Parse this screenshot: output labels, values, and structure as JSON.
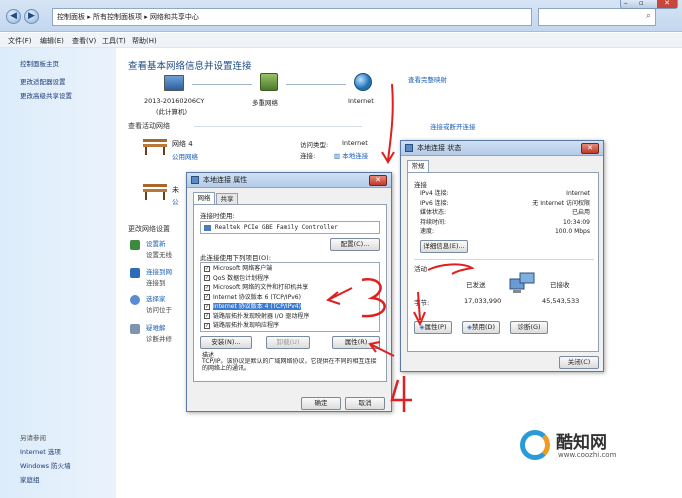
{
  "breadcrumb": {
    "root": "控制面板",
    "mid": "所有控制面板项",
    "current": "网络和共享中心"
  },
  "menu": [
    "文件(F)",
    "编辑(E)",
    "查看(V)",
    "工具(T)",
    "帮助(H)"
  ],
  "sidebar": {
    "home": "控制面板主页",
    "links": [
      "更改适配器设置",
      "更改高级共享设置"
    ],
    "see_also_title": "另请参阅",
    "see_also": [
      "Internet 选项",
      "Windows 防火墙",
      "家庭组"
    ]
  },
  "main": {
    "title": "查看基本网络信息并设置连接",
    "full_map": "查看完整映射",
    "computer_name": "2013-20160206CY",
    "this_computer": "(此计算机)",
    "multi_network": "多重网络",
    "internet": "Internet",
    "active_title": "查看活动网络",
    "connect_disconnect": "连接或断开连接",
    "network1_name": "网络 4",
    "network1_type": "公用网络",
    "access_type_label": "访问类型:",
    "access_type_value": "Internet",
    "connections_label": "连接:",
    "connections_value": "本地连接",
    "network2_name": "未",
    "network2_type": "公",
    "change_title": "更改网络设置",
    "change_items": [
      "设置新",
      "设置无线",
      "连接到网",
      "连接到",
      "选择家",
      "访问位于",
      "疑难解",
      "诊断并修"
    ]
  },
  "props_dialog": {
    "title": "本地连接 属性",
    "tabs": [
      "网络",
      "共享"
    ],
    "connect_using_label": "连接时使用:",
    "adapter": "Realtek PCIe GBE Family Controller",
    "configure": "配置(C)...",
    "items_label": "此连接使用下列项目(O):",
    "items": [
      "Microsoft 网络客户端",
      "QoS 数据包计划程序",
      "Microsoft 网络的文件和打印机共享",
      "Internet 协议版本 6 (TCP/IPv6)",
      "Internet 协议版本 4 (TCP/IPv4)",
      "链路层拓扑发现映射器 I/O 驱动程序",
      "链路层拓扑发现响应程序"
    ],
    "install": "安装(N)...",
    "uninstall": "卸载(U)",
    "properties": "属性(R)",
    "desc_label": "描述",
    "desc_text": "TCP/IP。该协议是默认的广域网络协议，它提供在不同的相互连接的网络上的通讯。",
    "ok": "确定",
    "cancel": "取消"
  },
  "status_dialog": {
    "title": "本地连接 状态",
    "tab": "常规",
    "connection_label": "连接",
    "fields": [
      {
        "label": "IPv4 连接:",
        "value": "Internet"
      },
      {
        "label": "IPv6 连接:",
        "value": "无 Internet 访问权限"
      },
      {
        "label": "媒体状态:",
        "value": "已启用"
      },
      {
        "label": "持续时间:",
        "value": "10:34:09"
      },
      {
        "label": "速度:",
        "value": "100.0 Mbps"
      }
    ],
    "details": "详细信息(E)...",
    "activity_label": "活动",
    "sent_label": "已发送",
    "received_label": "已接收",
    "bytes_label": "字节:",
    "bytes_sent": "17,033,990",
    "bytes_received": "45,543,533",
    "properties": "属性(P)",
    "disable": "禁用(D)",
    "diagnose": "诊断(G)",
    "close": "关闭(C)"
  },
  "annotations": {
    "one": "1",
    "two": "2",
    "three": "3",
    "four": "4"
  },
  "watermark": {
    "brand": "酷知网",
    "url": "www.coozhi.com"
  },
  "colors": {
    "link": "#1b5db8",
    "annotation": "#e02020",
    "dialog_bg": "#f0f0f0"
  }
}
